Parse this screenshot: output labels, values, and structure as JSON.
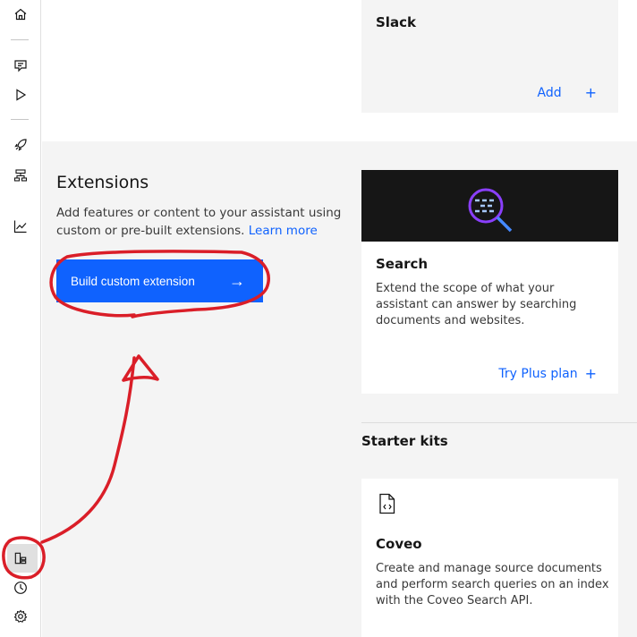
{
  "rail": {
    "icons": [
      "home-icon",
      "chat-icon",
      "play-icon",
      "rocket-icon",
      "flow-icon",
      "analytics-icon",
      "integrations-icon",
      "history-icon",
      "settings-icon"
    ]
  },
  "slack": {
    "title": "Slack",
    "add_label": "Add",
    "plus": "+"
  },
  "extensions": {
    "title": "Extensions",
    "description": "Add features or content to your assistant using custom or pre-built extensions.",
    "learn_more": "Learn more",
    "build_button": "Build custom extension",
    "arrow": "→"
  },
  "search_card": {
    "title": "Search",
    "description": "Extend the scope of what your assistant can answer by searching documents and websites.",
    "cta": "Try Plus plan",
    "plus": "+"
  },
  "starter_kits": {
    "title": "Starter kits"
  },
  "coveo_card": {
    "title": "Coveo",
    "description": "Create and manage source documents and perform search queries on an index with the Coveo Search API."
  },
  "colors": {
    "accent": "#0f62fe",
    "annotation": "#da1e28",
    "banner": "#161616"
  }
}
